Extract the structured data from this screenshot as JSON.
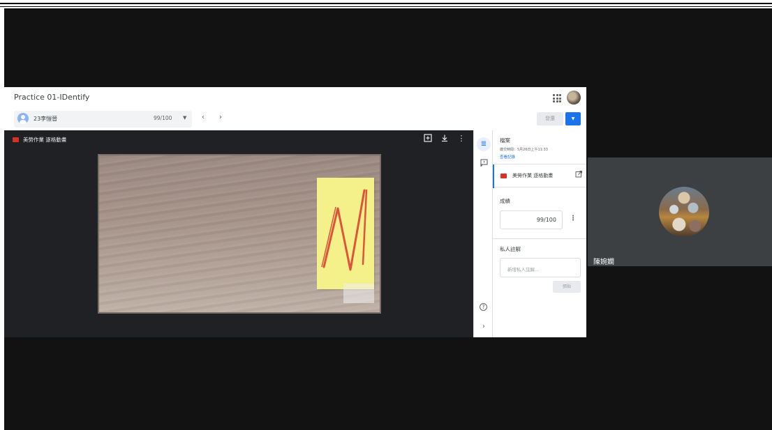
{
  "classroom": {
    "title": "Practice 01-IDentify",
    "student": {
      "name": "23李愷晉",
      "grade_display": "99/100"
    },
    "return_label": "發還",
    "viewer": {
      "file_name": "美勞作業 逐格動畫"
    },
    "panel": {
      "files_heading": "檔案",
      "submitted": "繳交時間：5月26日上午11:33",
      "history_link": "查看記錄",
      "attachment_name": "美勞作業 逐格動畫",
      "grade_heading": "成績",
      "grade_value": "99/100",
      "private_notes_heading": "私人註解",
      "notes_placeholder": "新增私人註解...",
      "post_label": "張貼"
    },
    "icons": {
      "apps": "apps-grid-icon",
      "prev": "chevron-left-icon",
      "next": "chevron-right-icon",
      "comment": "add-comment-icon",
      "download": "download-icon",
      "more": "more-vert-icon",
      "open": "open-in-new-icon",
      "help": "help-icon",
      "expand": "chevron-right-icon"
    }
  },
  "participant": {
    "name": "陳婉嫻"
  },
  "colors": {
    "accent": "#1a73e8",
    "video_bg": "#121212",
    "viewer_bg": "#202124",
    "sticky": "#f4f08a",
    "drawing": "#e0533a"
  }
}
